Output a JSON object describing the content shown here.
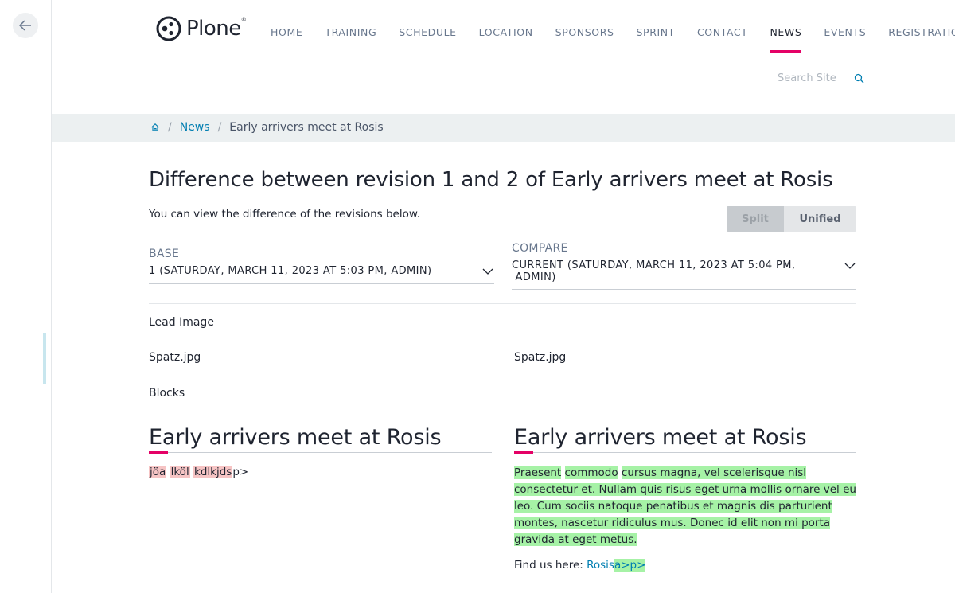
{
  "logo": {
    "text": "Plone",
    "tm": "®"
  },
  "nav": [
    {
      "label": "HOME"
    },
    {
      "label": "TRAINING"
    },
    {
      "label": "SCHEDULE"
    },
    {
      "label": "LOCATION"
    },
    {
      "label": "SPONSORS"
    },
    {
      "label": "SPRINT"
    },
    {
      "label": "CONTACT"
    },
    {
      "label": "NEWS",
      "active": true
    },
    {
      "label": "EVENTS"
    },
    {
      "label": "REGISTRATION"
    }
  ],
  "search": {
    "placeholder": "Search Site"
  },
  "breadcrumb": {
    "news": "News",
    "current": "Early arrivers meet at Rosis"
  },
  "page": {
    "title": "Difference between revision 1 and 2 of Early arrivers meet at Rosis",
    "subtitle": "You can view the difference of the revisions below.",
    "toggle": {
      "split": "Split",
      "unified": "Unified",
      "selected": "Split"
    }
  },
  "base": {
    "label": "BASE",
    "value": "1 (SATURDAY, MARCH 11, 2023 AT 5:03 PM,  ADMIN)"
  },
  "compare": {
    "label": "COMPARE",
    "value_line1": "CURRENT (SATURDAY, MARCH 11, 2023 AT 5:04 PM,",
    "value_line2": "ADMIN)"
  },
  "fields": {
    "lead_image": "Lead Image",
    "blocks": "Blocks"
  },
  "lead_image": {
    "left_file": "Spatz.jpg",
    "right_file": "Spatz.jpg"
  },
  "left": {
    "heading": "Early arrivers meet at Rosis",
    "del1": "jöa",
    "del2": "lköl",
    "del3": "kdlkjds",
    "tail": "p>"
  },
  "right": {
    "heading": "Early arrivers meet at Rosis",
    "ins1": "Praesent",
    "ins2": "commodo",
    "ins3": "cursus magna, vel scelerisque nisl consectetur et. Nullam quis risus eget urna mollis ornare vel eu leo. Cum sociis natoque penatibus et magnis dis parturient montes, nascetur ridiculus mus. Donec id elit non mi porta gravida at eget metus.",
    "findus_label": "Find us here: ",
    "findus_link": "Rosis",
    "findus_ins": "a>p>"
  },
  "colors": {
    "accent": "#e40166",
    "link": "#007eb1",
    "insert": "#a6f2a6",
    "delete": "#f6c4c4"
  }
}
